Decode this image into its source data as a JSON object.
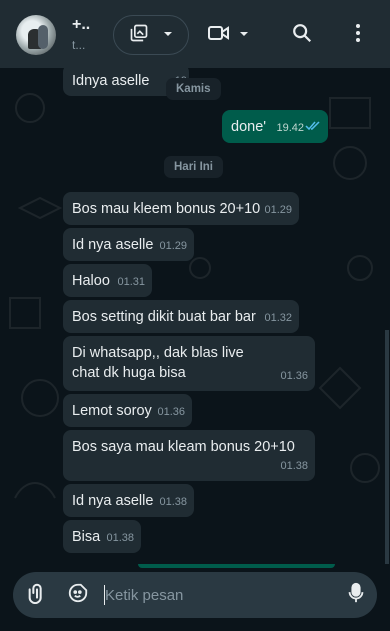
{
  "header": {
    "contact_name": "+..",
    "contact_sub": "t...",
    "icons": {
      "gallery": "photo-library-icon",
      "gallery_dropdown": "chevron-down-icon",
      "video": "video-camera-icon",
      "video_dropdown": "chevron-down-icon",
      "search": "search-icon",
      "menu": "more-vertical-icon"
    }
  },
  "messages": [
    {
      "id": "m0",
      "text": "Idnya aselle",
      "time": "19",
      "direction": "in"
    },
    {
      "id": "d1",
      "text": "Kamis",
      "type": "date"
    },
    {
      "id": "m1",
      "text": "done'",
      "time": "19.42",
      "direction": "out",
      "status": "read"
    },
    {
      "id": "d2",
      "text": "Hari Ini",
      "type": "date"
    },
    {
      "id": "m2",
      "text": "Bos mau kleem bonus 20+10",
      "time": "01.29",
      "direction": "in"
    },
    {
      "id": "m3",
      "text": "Id nya aselle",
      "time": "01.29",
      "direction": "in"
    },
    {
      "id": "m4",
      "text": "Haloo",
      "time": "01.31",
      "direction": "in"
    },
    {
      "id": "m5",
      "text": "Bos setting dikit buat bar bar",
      "time": "01.32",
      "direction": "in"
    },
    {
      "id": "m6",
      "text": "Di whatsapp,, dak blas live chat dk huga bisa",
      "time": "01.36",
      "direction": "in"
    },
    {
      "id": "m7",
      "text": "Lemot soroy",
      "time": "01.36",
      "direction": "in"
    },
    {
      "id": "m8",
      "text": "Bos saya mau kleam bonus 20+10",
      "time": "01.38",
      "direction": "in"
    },
    {
      "id": "m9",
      "text": "Id nya aselle",
      "time": "01.38",
      "direction": "in"
    },
    {
      "id": "m10",
      "text": "Bisa",
      "time": "01.38",
      "direction": "in"
    }
  ],
  "composer": {
    "placeholder": "Ketik pesan",
    "value": "",
    "icons": {
      "attach": "paperclip-icon",
      "sticker": "sticker-icon",
      "mic": "microphone-icon"
    }
  },
  "colors": {
    "header_bg": "#202c33",
    "chat_bg": "#0b141a",
    "incoming_bubble": "#202c33",
    "outgoing_bubble": "#005c4b",
    "read_tick": "#53bdeb",
    "composer_bg": "#2a3942"
  }
}
